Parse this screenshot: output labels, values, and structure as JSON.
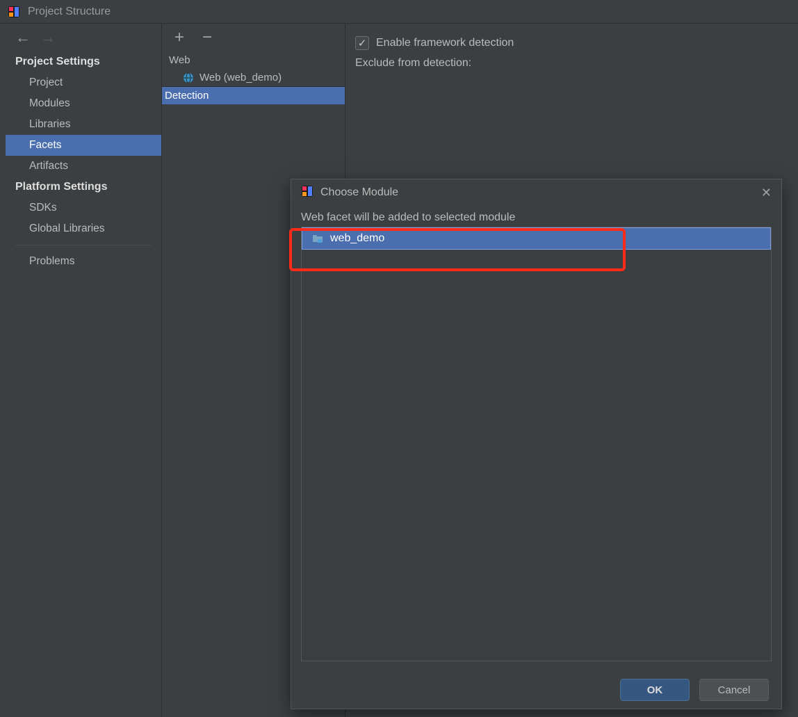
{
  "window": {
    "title": "Project Structure"
  },
  "sidebar": {
    "section1": "Project Settings",
    "items1": [
      "Project",
      "Modules",
      "Libraries",
      "Facets",
      "Artifacts"
    ],
    "section2": "Platform Settings",
    "items2": [
      "SDKs",
      "Global Libraries"
    ],
    "problems": "Problems",
    "selected": "Facets"
  },
  "middle": {
    "tree_root": "Web",
    "tree_child": "Web (web_demo)",
    "tree_detection": "Detection",
    "selected": "Detection"
  },
  "right": {
    "enable_label": "Enable framework detection",
    "enable_checked": true,
    "exclude_label": "Exclude from detection:"
  },
  "dialog": {
    "title": "Choose Module",
    "message": "Web facet will be added to selected module",
    "modules": [
      "web_demo"
    ],
    "selected": "web_demo",
    "ok": "OK",
    "cancel": "Cancel"
  }
}
